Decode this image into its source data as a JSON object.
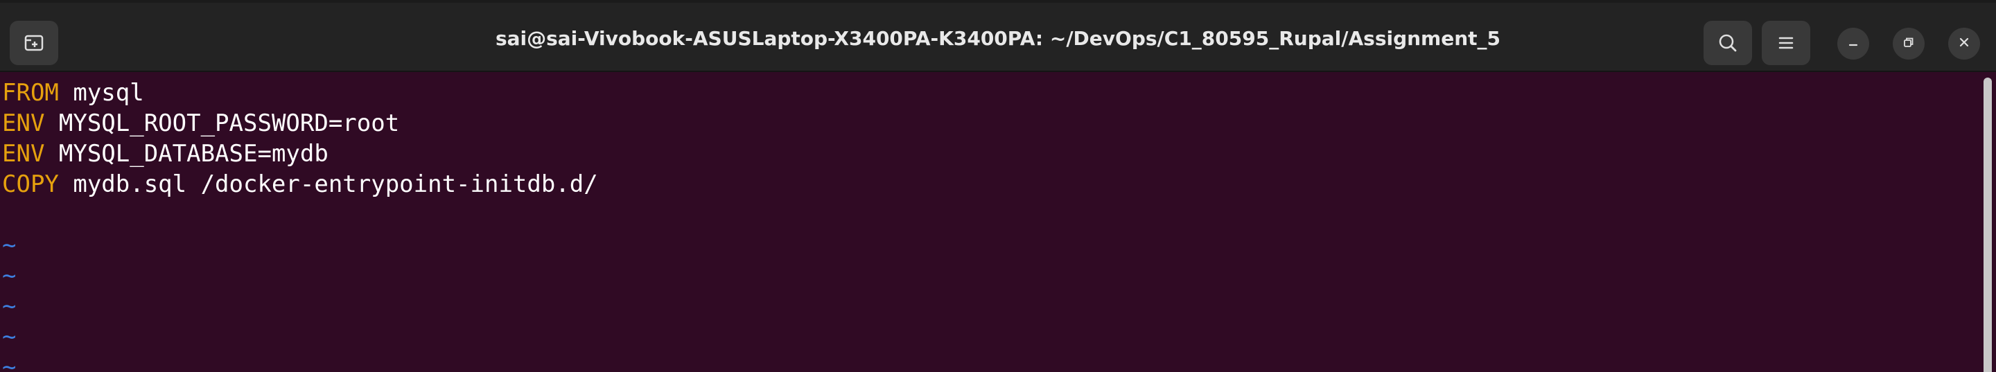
{
  "window": {
    "title": "sai@sai-Vivobook-ASUSLaptop-X3400PA-K3400PA: ~/DevOps/C1_80595_Rupal/Assignment_5"
  },
  "icons": {
    "new_tab": "new-tab-icon",
    "search": "search-icon",
    "menu": "hamburger-menu-icon",
    "minimize": "minimize-icon",
    "maximize": "restore-icon",
    "close": "close-icon"
  },
  "colors": {
    "terminal_bg": "#300a24",
    "keyword": "#e6a10e",
    "text": "#ffffff",
    "tilde": "#3d7fe0",
    "titlebar": "#232323"
  },
  "editor": {
    "lines": [
      {
        "keyword": "FROM",
        "text": " mysql"
      },
      {
        "keyword": "ENV",
        "text": " MYSQL_ROOT_PASSWORD=root"
      },
      {
        "keyword": "ENV",
        "text": " MYSQL_DATABASE=mydb"
      },
      {
        "keyword": "COPY",
        "text": " mydb.sql /docker-entrypoint-initdb.d/"
      }
    ],
    "tilde": "~"
  }
}
